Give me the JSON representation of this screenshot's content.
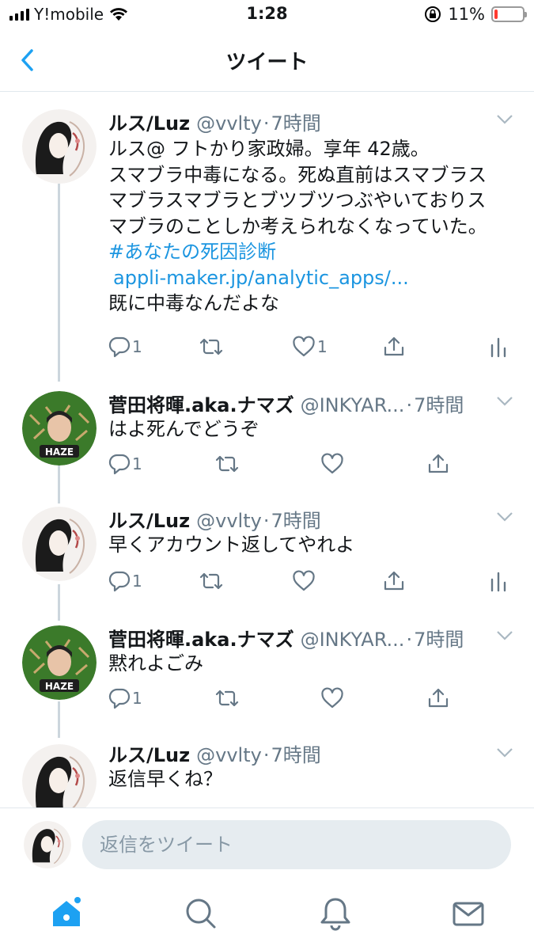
{
  "status_bar": {
    "carrier": "Y!mobile",
    "time": "1:28",
    "battery_percent": "11%",
    "battery_level": 0.11
  },
  "nav": {
    "title": "ツイート"
  },
  "colors": {
    "accent": "#1da1f2",
    "link": "#1b95e0",
    "secondary_text": "#657786",
    "battery_low": "#ff3b30"
  },
  "tweets": [
    {
      "name": "ルス/Luz",
      "handle": "@vvlty",
      "dot": "·",
      "time": "7時間",
      "lines": [
        "ルス@ フトかり家政婦。享年 42歳。",
        "スマブラ中毒になる。死ぬ直前はスマブラス",
        "マブラスマブラとブツブツつぶやいておりス",
        "マブラのことしか考えられなくなっていた。"
      ],
      "hashtag": "#あなたの死因診断",
      "link": "appli-maker.jp/analytic_apps/...",
      "last_line": "既に中毒なんだよな",
      "reply_count": "1",
      "like_count": "1"
    },
    {
      "name": "菅田将暉.aka.ナマズ",
      "handle": "@INKYAR...",
      "dot": "·",
      "time": "7時間",
      "text": "はよ死んでどうぞ",
      "reply_count": "1",
      "avatar_label": "HAZE"
    },
    {
      "name": "ルス/Luz",
      "handle": "@vvlty",
      "dot": "·",
      "time": "7時間",
      "text": "早くアカウント返してやれよ",
      "reply_count": "1"
    },
    {
      "name": "菅田将暉.aka.ナマズ",
      "handle": "@INKYAR...",
      "dot": "·",
      "time": "7時間",
      "text": "黙れよごみ",
      "reply_count": "1",
      "avatar_label": "HAZE"
    },
    {
      "name": "ルス/Luz",
      "handle": "@vvlty",
      "dot": "·",
      "time": "7時間",
      "text": "返信早くね？"
    }
  ],
  "reply": {
    "placeholder": "返信をツイート"
  },
  "tabs": [
    "home-icon",
    "search-icon",
    "notifications-icon",
    "messages-icon"
  ]
}
